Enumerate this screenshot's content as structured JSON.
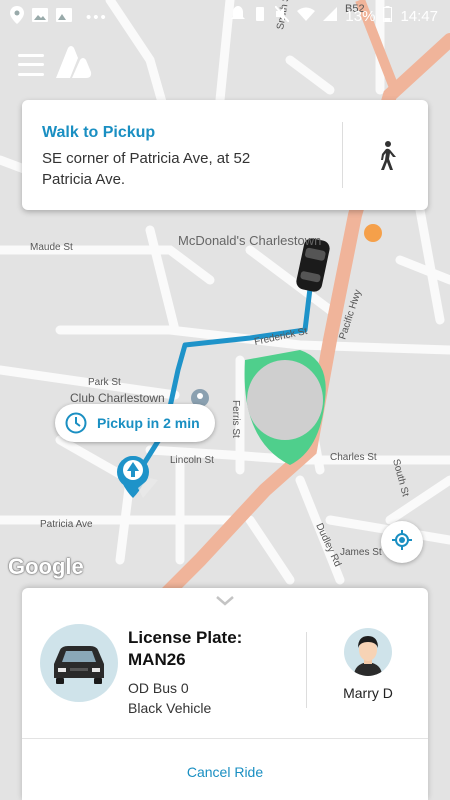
{
  "status_bar": {
    "battery": "13%",
    "time": "14:47",
    "dots": "•••"
  },
  "map": {
    "labels": {
      "mcdonalds": "McDonald's Charlestown",
      "pacific_hwy": "Pacific Hwy",
      "frederick_st": "Frederick St",
      "park_st": "Park St",
      "club": "Club Charlestown",
      "ferris_st": "Ferris St",
      "lincoln_st": "Lincoln St",
      "charles_st": "Charles St",
      "patricia_ave": "Patricia Ave",
      "dudley_rd": "Dudley Rd",
      "james_st": "James St",
      "smith_st": "Smith St",
      "south_st": "South St",
      "maude_st": "Maude St",
      "b52": "B52"
    },
    "google_logo": "Google"
  },
  "walk_card": {
    "title": "Walk to Pickup",
    "description": "SE corner of Patricia Ave, at 52 Patricia Ave."
  },
  "pickup_pill": {
    "label": "Pickup in 2 min"
  },
  "ride_sheet": {
    "plate_label": "License Plate:",
    "plate_value": "MAN26",
    "vehicle_name": "OD Bus 0",
    "vehicle_color": "Black Vehicle",
    "driver_name": "Marry D",
    "cancel_label": "Cancel Ride"
  },
  "colors": {
    "accent": "#1a8fc2",
    "route": "#1e93c9",
    "highway": "#f0b49a",
    "park": "#4fcf8c"
  }
}
